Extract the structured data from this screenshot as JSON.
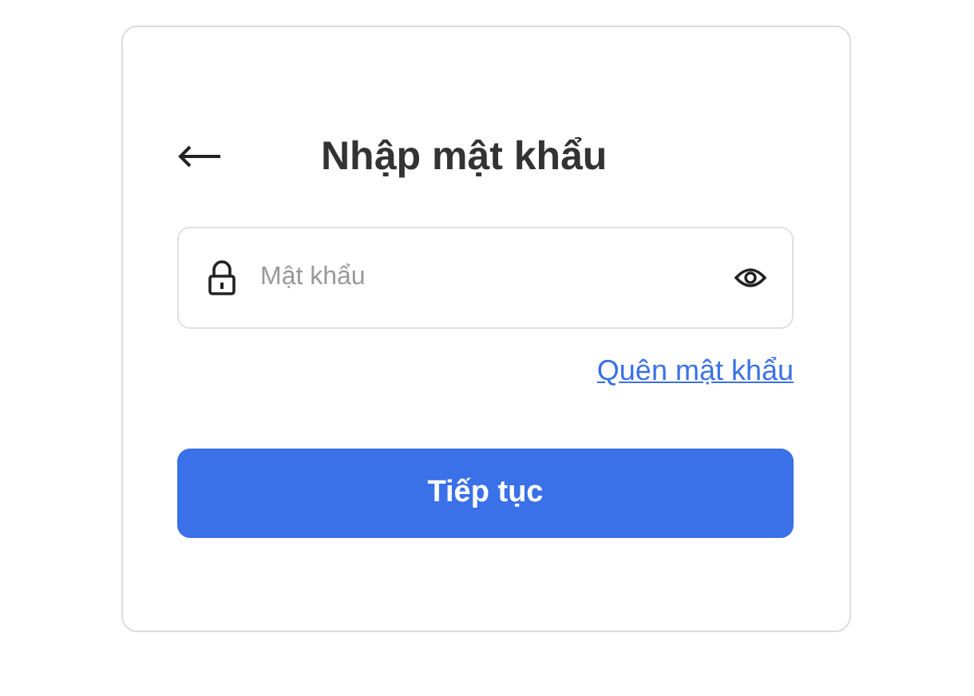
{
  "header": {
    "title": "Nhập mật khẩu"
  },
  "password_field": {
    "placeholder": "Mật khẩu"
  },
  "forgot_link": "Quên mật khẩu",
  "buttons": [
    "Tiếp tục"
  ]
}
